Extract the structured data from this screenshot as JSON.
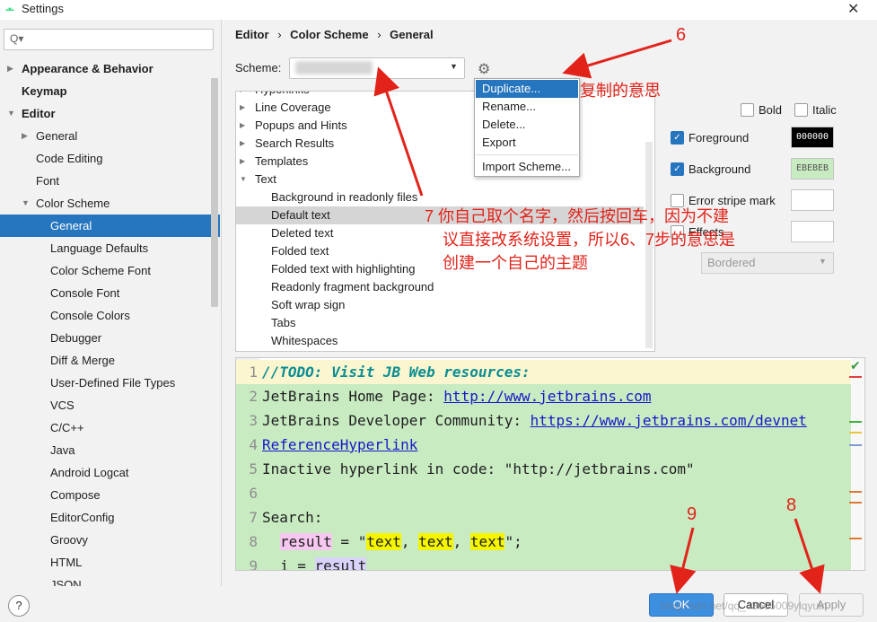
{
  "window": {
    "title": "Settings",
    "close_glyph": "✕"
  },
  "search": {
    "placeholder": "Q▾",
    "value": ""
  },
  "sidebar": {
    "items": [
      {
        "label": "Appearance & Behavior",
        "bold": true,
        "expanded": false
      },
      {
        "label": "Keymap",
        "bold": true
      },
      {
        "label": "Editor",
        "bold": true,
        "expanded": true
      },
      {
        "label": "General"
      },
      {
        "label": "Code Editing"
      },
      {
        "label": "Font"
      },
      {
        "label": "Color Scheme"
      },
      {
        "label": "General",
        "selected": true
      },
      {
        "label": "Language Defaults"
      },
      {
        "label": "Color Scheme Font"
      },
      {
        "label": "Console Font"
      },
      {
        "label": "Console Colors"
      },
      {
        "label": "Debugger"
      },
      {
        "label": "Diff & Merge"
      },
      {
        "label": "User-Defined File Types"
      },
      {
        "label": "VCS"
      },
      {
        "label": "C/C++"
      },
      {
        "label": "Java"
      },
      {
        "label": "Android Logcat"
      },
      {
        "label": "Compose"
      },
      {
        "label": "EditorConfig"
      },
      {
        "label": "Groovy"
      },
      {
        "label": "HTML"
      },
      {
        "label": "JSON"
      }
    ]
  },
  "breadcrumb": {
    "part1": "Editor",
    "part2": "Color Scheme",
    "part3": "General",
    "sep": "›"
  },
  "scheme": {
    "label": "Scheme:",
    "value": ""
  },
  "popup_menu": {
    "items": [
      "Duplicate...",
      "Rename...",
      "Delete...",
      "Export",
      "Import Scheme..."
    ],
    "selected_index": 0
  },
  "list": {
    "items": [
      {
        "label": "Hyperlinks",
        "expandable": true
      },
      {
        "label": "Line Coverage",
        "expandable": true
      },
      {
        "label": "Popups and Hints",
        "expandable": true
      },
      {
        "label": "Search Results",
        "expandable": true
      },
      {
        "label": "Templates",
        "expandable": true
      },
      {
        "label": "Text",
        "expandable": true,
        "expanded": true
      },
      {
        "label": "Background in readonly files"
      },
      {
        "label": "Default text",
        "selected": true
      },
      {
        "label": "Deleted text"
      },
      {
        "label": "Folded text"
      },
      {
        "label": "Folded text with highlighting"
      },
      {
        "label": "Readonly fragment background"
      },
      {
        "label": "Soft wrap sign"
      },
      {
        "label": "Tabs"
      },
      {
        "label": "Whitespaces"
      }
    ]
  },
  "attributes": {
    "bold_label": "Bold",
    "italic_label": "Italic",
    "foreground_label": "Foreground",
    "foreground_value": "000000",
    "foreground_color": "#000000",
    "background_label": "Background",
    "background_value": "EBEBEB",
    "background_color": "#c8ebc2",
    "error_stripe_label": "Error stripe mark",
    "effects_label": "Effects",
    "effects_value": "Bordered"
  },
  "code": {
    "line1": {
      "num": "1",
      "text": "//TODO: Visit JB Web resources:"
    },
    "line2": {
      "num": "2",
      "prefix": "JetBrains Home Page: ",
      "link": "http://www.jetbrains.com"
    },
    "line3": {
      "num": "3",
      "prefix": "JetBrains Developer Community: ",
      "link": "https://www.jetbrains.com/devnet"
    },
    "line4": {
      "num": "4",
      "link": "ReferenceHyperlink"
    },
    "line5": {
      "num": "5",
      "text": "Inactive hyperlink in code: \"http://jetbrains.com\""
    },
    "line6": {
      "num": "6",
      "text": ""
    },
    "line7": {
      "num": "7",
      "text": "Search:"
    },
    "line8": {
      "num": "8",
      "var": "result",
      "eq": " = \"",
      "word": "text",
      "comma": ", ",
      "end": "\";"
    },
    "line9": {
      "num": "9",
      "var": "i",
      "eq": " = ",
      "ref": "result"
    }
  },
  "footer": {
    "help": "?",
    "ok": "OK",
    "cancel": "Cancel",
    "apply": "Apply"
  },
  "annotations": {
    "n6": "6",
    "n6_text": "复制的意思",
    "n7_line1": "7 你自己取个名字，然后按回车，因为不建",
    "n7_line2": "议直接改系统设置，所以6、7步的意思是",
    "n7_line3": "创建一个自己的主题",
    "n8": "8",
    "n9": "9",
    "watermark": "blog.csdn.net/qq_43605009ylqyuln"
  },
  "colors": {
    "accent": "#2675bf",
    "annotation": "#e2231a",
    "link": "#1a16c8"
  },
  "icons": [
    "android-icon",
    "search-icon",
    "gear-icon",
    "close-icon",
    "help-icon",
    "check-icon"
  ]
}
